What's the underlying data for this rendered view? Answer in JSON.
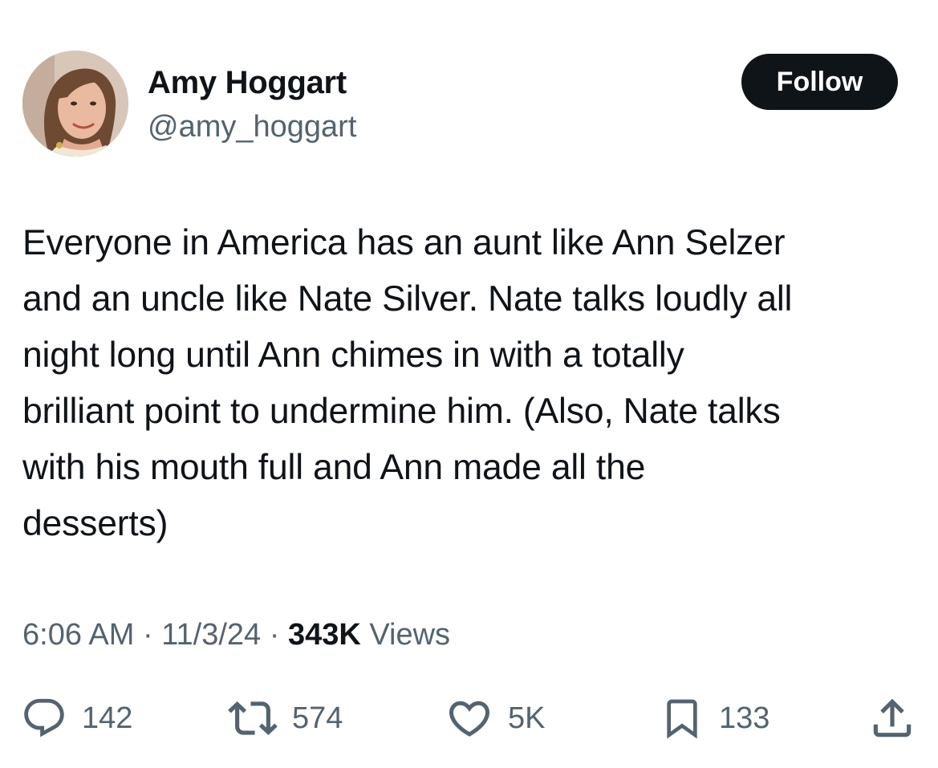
{
  "author": {
    "name": "Amy Hoggart",
    "handle": "@amy_hoggart"
  },
  "follow_label": "Follow",
  "tweet": {
    "lines": [
      "Everyone in America has an aunt like Ann Selzer",
      "and an uncle like Nate Silver. Nate talks loudly all",
      "night long until Ann chimes in with a totally",
      "brilliant point to undermine him. (Also, Nate talks",
      "with his mouth full and Ann made all the",
      "desserts)"
    ]
  },
  "meta": {
    "time": "6:06 AM",
    "separator": " · ",
    "date": "11/3/24",
    "views_count": "343K",
    "views_label": " Views"
  },
  "actions": {
    "replies": "142",
    "retweets": "574",
    "likes": "5K",
    "bookmarks": "133"
  },
  "icons": {
    "reply": "reply-icon",
    "retweet": "retweet-icon",
    "like": "heart-icon",
    "bookmark": "bookmark-icon",
    "share": "share-icon"
  },
  "colors": {
    "text": "#0f1419",
    "secondary": "#536471",
    "button_bg": "#0f1419",
    "button_text": "#ffffff"
  }
}
